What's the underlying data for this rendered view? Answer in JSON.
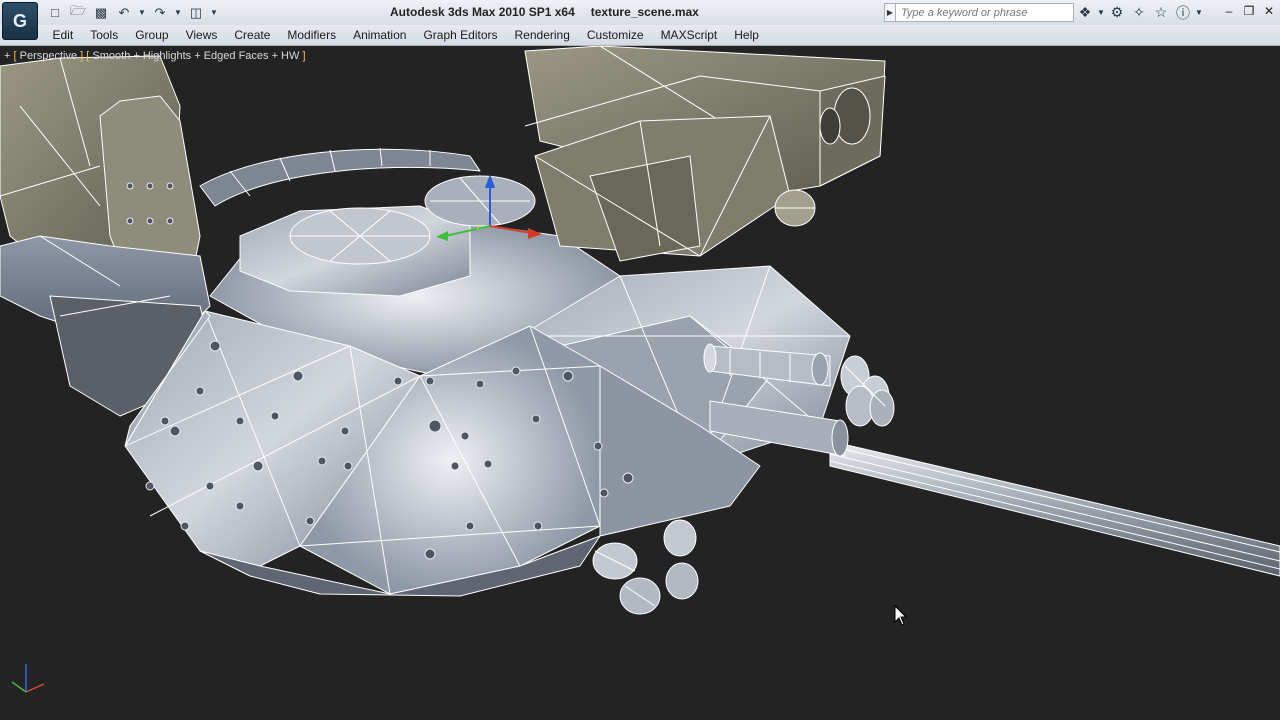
{
  "window": {
    "app_title": "Autodesk 3ds Max  2010 SP1 x64",
    "file_name": "texture_scene.max",
    "app_icon_letter": "G"
  },
  "quick_access": {
    "icons": [
      "new-icon",
      "open-icon",
      "save-icon",
      "undo-icon",
      "redo-icon",
      "project-folder-icon"
    ]
  },
  "search": {
    "placeholder": "Type a keyword or phrase"
  },
  "infocenter": {
    "icons": [
      "binoculars-icon",
      "communication-center-icon",
      "favorites-star-icon",
      "help-icon"
    ]
  },
  "menu": {
    "items": [
      "Edit",
      "Tools",
      "Group",
      "Views",
      "Create",
      "Modifiers",
      "Animation",
      "Graph Editors",
      "Rendering",
      "Customize",
      "MAXScript",
      "Help"
    ]
  },
  "viewport": {
    "label_plus": "+",
    "label_view": "Perspective",
    "label_shading": "Smooth + Highlights + Edged Faces + HW",
    "background": "#232323"
  },
  "colors": {
    "mesh_fill": "#8a93a2",
    "mesh_highlight": "#c9ced6",
    "wire": "#ffffff",
    "olive_fill": "#7c7a68",
    "gizmo_z": "#2a5bd8",
    "gizmo_y": "#3fbf3f",
    "gizmo_x": "#d83a2a"
  }
}
